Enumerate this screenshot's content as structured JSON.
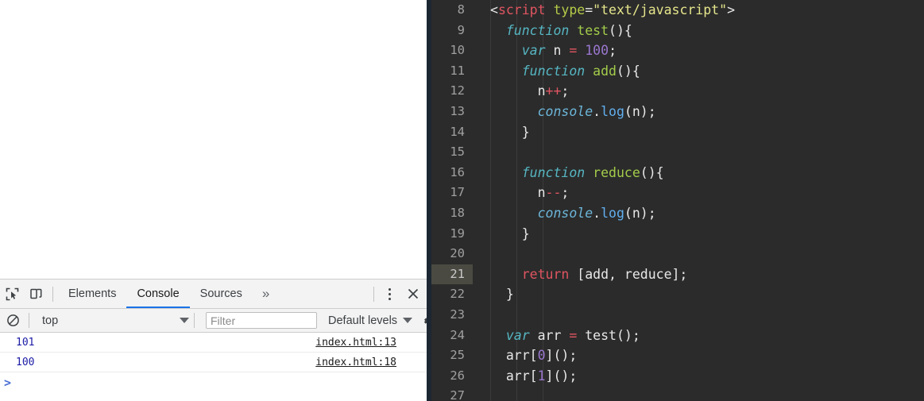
{
  "devtools": {
    "icons": {
      "inspect": "inspect-element-icon",
      "device": "device-toolbar-icon",
      "overflow": "»",
      "close": "×"
    },
    "tabs": [
      {
        "label": "Elements",
        "active": false
      },
      {
        "label": "Console",
        "active": true
      },
      {
        "label": "Sources",
        "active": false
      }
    ],
    "filterbar": {
      "context_value": "top",
      "filter_placeholder": "Filter",
      "levels_label": "Default levels"
    },
    "console": {
      "messages": [
        {
          "value": "101",
          "source": "index.html:13"
        },
        {
          "value": "100",
          "source": "index.html:18"
        }
      ],
      "prompt": ">"
    },
    "colors": {
      "accent": "#1a73e8",
      "chrome": "#f3f3f3",
      "value": "#1a1aa6"
    }
  },
  "editor": {
    "background": "#2b2b2b",
    "active_line": 21,
    "lines": [
      {
        "n": 8,
        "tokens": [
          {
            "t": "<",
            "c": "tk-punct"
          },
          {
            "t": "script",
            "c": "tk-tag"
          },
          {
            "t": " ",
            "c": "tk-plain"
          },
          {
            "t": "type",
            "c": "tk-attr"
          },
          {
            "t": "=",
            "c": "tk-plain"
          },
          {
            "t": "\"text/javascript\"",
            "c": "tk-string"
          },
          {
            "t": ">",
            "c": "tk-punct"
          }
        ]
      },
      {
        "n": 9,
        "tokens": [
          {
            "t": "  ",
            "c": "tk-plain"
          },
          {
            "t": "function",
            "c": "tk-kw"
          },
          {
            "t": " ",
            "c": "tk-plain"
          },
          {
            "t": "test",
            "c": "tk-fn"
          },
          {
            "t": "(){",
            "c": "tk-plain"
          }
        ]
      },
      {
        "n": 10,
        "tokens": [
          {
            "t": "    ",
            "c": "tk-plain"
          },
          {
            "t": "var",
            "c": "tk-kw"
          },
          {
            "t": " n ",
            "c": "tk-plain"
          },
          {
            "t": "=",
            "c": "tk-op"
          },
          {
            "t": " ",
            "c": "tk-plain"
          },
          {
            "t": "100",
            "c": "tk-num"
          },
          {
            "t": ";",
            "c": "tk-plain"
          }
        ]
      },
      {
        "n": 11,
        "tokens": [
          {
            "t": "    ",
            "c": "tk-plain"
          },
          {
            "t": "function",
            "c": "tk-kw"
          },
          {
            "t": " ",
            "c": "tk-plain"
          },
          {
            "t": "add",
            "c": "tk-fn"
          },
          {
            "t": "(){",
            "c": "tk-plain"
          }
        ]
      },
      {
        "n": 12,
        "tokens": [
          {
            "t": "      n",
            "c": "tk-plain"
          },
          {
            "t": "++",
            "c": "tk-op"
          },
          {
            "t": ";",
            "c": "tk-plain"
          }
        ]
      },
      {
        "n": 13,
        "tokens": [
          {
            "t": "      ",
            "c": "tk-plain"
          },
          {
            "t": "console",
            "c": "tk-obj"
          },
          {
            "t": ".",
            "c": "tk-plain"
          },
          {
            "t": "log",
            "c": "tk-prop"
          },
          {
            "t": "(n);",
            "c": "tk-plain"
          }
        ]
      },
      {
        "n": 14,
        "tokens": [
          {
            "t": "    }",
            "c": "tk-plain"
          }
        ]
      },
      {
        "n": 15,
        "tokens": [
          {
            "t": "",
            "c": "tk-plain"
          }
        ]
      },
      {
        "n": 16,
        "tokens": [
          {
            "t": "    ",
            "c": "tk-plain"
          },
          {
            "t": "function",
            "c": "tk-kw"
          },
          {
            "t": " ",
            "c": "tk-plain"
          },
          {
            "t": "reduce",
            "c": "tk-fn"
          },
          {
            "t": "(){",
            "c": "tk-plain"
          }
        ]
      },
      {
        "n": 17,
        "tokens": [
          {
            "t": "      n",
            "c": "tk-plain"
          },
          {
            "t": "--",
            "c": "tk-op"
          },
          {
            "t": ";",
            "c": "tk-plain"
          }
        ]
      },
      {
        "n": 18,
        "tokens": [
          {
            "t": "      ",
            "c": "tk-plain"
          },
          {
            "t": "console",
            "c": "tk-obj"
          },
          {
            "t": ".",
            "c": "tk-plain"
          },
          {
            "t": "log",
            "c": "tk-prop"
          },
          {
            "t": "(n);",
            "c": "tk-plain"
          }
        ]
      },
      {
        "n": 19,
        "tokens": [
          {
            "t": "    }",
            "c": "tk-plain"
          }
        ]
      },
      {
        "n": 20,
        "tokens": [
          {
            "t": "",
            "c": "tk-plain"
          }
        ]
      },
      {
        "n": 21,
        "tokens": [
          {
            "t": "    ",
            "c": "tk-plain"
          },
          {
            "t": "return",
            "c": "tk-kw-plain"
          },
          {
            "t": " [add, reduce];",
            "c": "tk-plain"
          }
        ]
      },
      {
        "n": 22,
        "tokens": [
          {
            "t": "  }",
            "c": "tk-plain"
          }
        ]
      },
      {
        "n": 23,
        "tokens": [
          {
            "t": "",
            "c": "tk-plain"
          }
        ]
      },
      {
        "n": 24,
        "tokens": [
          {
            "t": "  ",
            "c": "tk-plain"
          },
          {
            "t": "var",
            "c": "tk-kw"
          },
          {
            "t": " arr ",
            "c": "tk-plain"
          },
          {
            "t": "=",
            "c": "tk-op"
          },
          {
            "t": " test();",
            "c": "tk-plain"
          }
        ]
      },
      {
        "n": 25,
        "tokens": [
          {
            "t": "  arr[",
            "c": "tk-plain"
          },
          {
            "t": "0",
            "c": "tk-num"
          },
          {
            "t": "]();",
            "c": "tk-plain"
          }
        ]
      },
      {
        "n": 26,
        "tokens": [
          {
            "t": "  arr[",
            "c": "tk-plain"
          },
          {
            "t": "1",
            "c": "tk-num"
          },
          {
            "t": "]();",
            "c": "tk-plain"
          }
        ]
      },
      {
        "n": 27,
        "tokens": [
          {
            "t": "",
            "c": "tk-plain"
          }
        ]
      }
    ]
  }
}
